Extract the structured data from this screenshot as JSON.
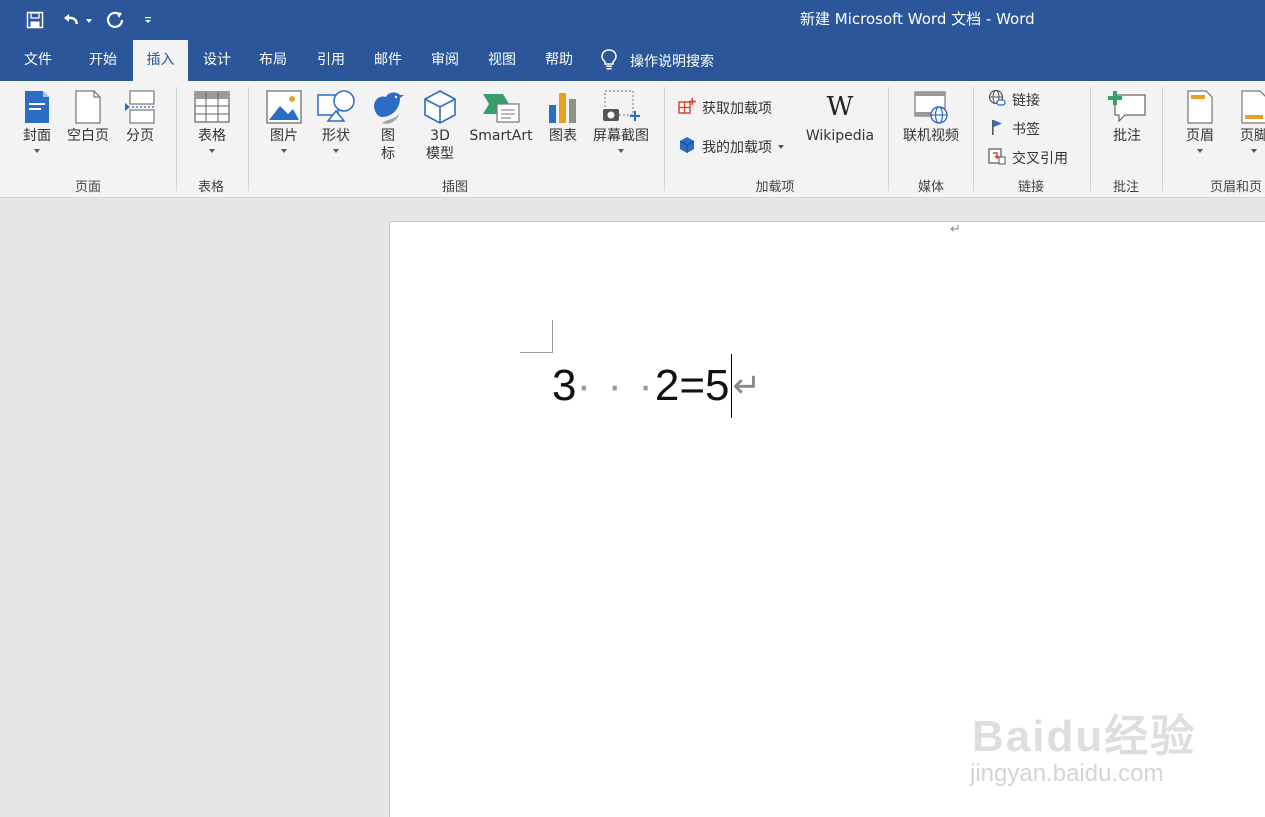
{
  "window": {
    "title": "新建 Microsoft Word 文档  -  Word"
  },
  "tabs": [
    {
      "label": "文件"
    },
    {
      "label": "开始"
    },
    {
      "label": "插入"
    },
    {
      "label": "设计"
    },
    {
      "label": "布局"
    },
    {
      "label": "引用"
    },
    {
      "label": "邮件"
    },
    {
      "label": "审阅"
    },
    {
      "label": "视图"
    },
    {
      "label": "帮助"
    }
  ],
  "active_tab": "插入",
  "tell_me": {
    "label": "操作说明搜索",
    "icon": "lightbulb-icon"
  },
  "ribbon": {
    "groups": {
      "pages": "页面",
      "tables": "表格",
      "illustrations": "插图",
      "addins": "加载项",
      "media": "媒体",
      "links": "链接",
      "comments": "批注",
      "header_footer": "页眉和页"
    },
    "buttons": {
      "cover": "封面",
      "blank_page": "空白页",
      "page_break": "分页",
      "table": "表格",
      "picture": "图片",
      "shapes": "形状",
      "icons_line1": "图",
      "icons_line2": "标",
      "model_3d_line1": "3D",
      "model_3d_line2": "模型",
      "smartart": "SmartArt",
      "chart": "图表",
      "screenshot": "屏幕截图",
      "get_addins": "获取加载项",
      "my_addins": "我的加载项",
      "wikipedia": "Wikipedia",
      "wiki_glyph": "W",
      "online_video": "联机视频",
      "link": "链接",
      "bookmark": "书签",
      "cross_ref": "交叉引用",
      "comment": "批注",
      "header": "页眉",
      "footer": "页脚"
    }
  },
  "document": {
    "para_mark": "↵",
    "equation": {
      "a": "3",
      "dots": "· · ·",
      "rest": "2=5"
    }
  },
  "watermark": {
    "text": "Baidu经验",
    "sub": "jingyan.baidu.com"
  },
  "colors": {
    "brand": "#2b579a",
    "ribbon_bg": "#f3f3f3",
    "canvas_bg": "#e6e6e6"
  }
}
